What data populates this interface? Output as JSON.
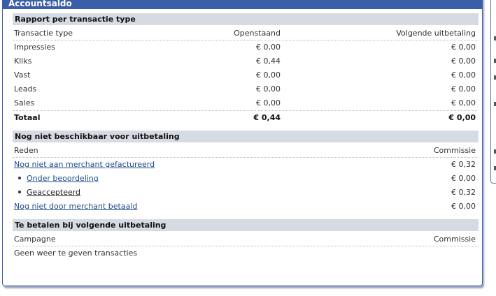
{
  "header": {
    "title": "Accountsaldo"
  },
  "report": {
    "title": "Rapport per transactie type",
    "columns": [
      "Transactie type",
      "Openstaand",
      "Volgende uitbetaling"
    ],
    "rows": [
      [
        "Impressies",
        "€ 0,00",
        "€ 0,00"
      ],
      [
        "Kliks",
        "€ 0,44",
        "€ 0,00"
      ],
      [
        "Vast",
        "€ 0,00",
        "€ 0,00"
      ],
      [
        "Leads",
        "€ 0,00",
        "€ 0,00"
      ],
      [
        "Sales",
        "€ 0,00",
        "€ 0,00"
      ]
    ],
    "total": [
      "Totaal",
      "€ 0,44",
      "€ 0,00"
    ]
  },
  "pending": {
    "title": "Nog niet beschikbaar voor uitbetaling",
    "columns": [
      "Reden",
      "Commissie"
    ],
    "rows": [
      {
        "label": "Nog niet aan merchant gefactureerd",
        "value": "€ 0,32"
      },
      {
        "label": "Onder beoordeling",
        "value": "€ 0,00"
      },
      {
        "label": "Geaccepteerd",
        "value": "€ 0,32"
      },
      {
        "label": "Nog niet door merchant betaald",
        "value": "€ 0,00"
      }
    ]
  },
  "next_payout": {
    "title": "Te betalen bij volgende uitbetaling",
    "columns": [
      "Campagne",
      "Commissie"
    ],
    "empty_message": "Geen weer te geven transacties"
  },
  "colors": {
    "header_bg": "#3a5fa8",
    "section_bg": "#d6dae2",
    "link": "#1f4a8c"
  }
}
